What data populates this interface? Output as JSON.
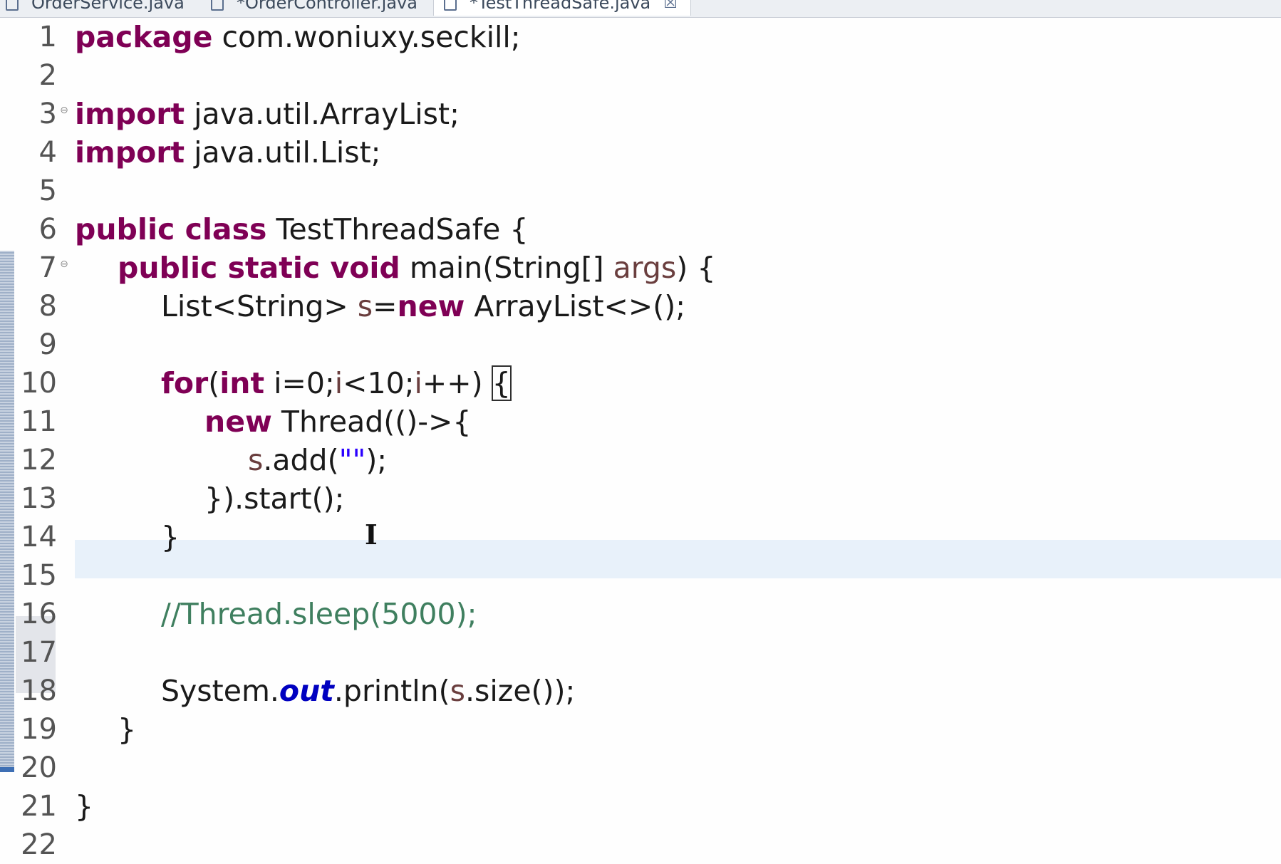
{
  "tabs": [
    {
      "label": "OrderService.java",
      "active": false
    },
    {
      "label": "*OrderController.java",
      "active": false
    },
    {
      "label": "*TestThreadSafe.java",
      "active": true,
      "close": "☒"
    }
  ],
  "gutter": {
    "line_numbers": [
      "1",
      "2",
      "3",
      "4",
      "5",
      "6",
      "7",
      "8",
      "9",
      "10",
      "11",
      "12",
      "13",
      "14",
      "15",
      "16",
      "17",
      "18",
      "19",
      "20",
      "21",
      "22"
    ],
    "fold_markers": {
      "3": "⊖",
      "7": "⊖"
    }
  },
  "code": {
    "l1_kw": "package",
    "l1_rest": " com.woniuxy.seckill;",
    "l3_kw": "import",
    "l3_rest": " java.util.ArrayList;",
    "l4_kw": "import",
    "l4_rest": " java.util.List;",
    "l6_kw": "public class",
    "l6_rest": " TestThreadSafe {",
    "l7_kw": "public static void",
    "l7_mid": " main(String[] ",
    "l7_var": "args",
    "l7_end": ") {",
    "l8_a": "List<String> ",
    "l8_var": "s",
    "l8_eq": "=",
    "l8_kw": "new",
    "l8_end": " ArrayList<>();",
    "l10_kw1": "for",
    "l10_p": "(",
    "l10_kw2": "int",
    "l10_a": " i=0;",
    "l10_b": "i",
    "l10_c": "<10;",
    "l10_d": "i",
    "l10_e": "++) ",
    "l10_brace": "{",
    "l11_kw": "new",
    "l11_rest": " Thread(()->{",
    "l12_var": "s",
    "l12_a": ".add(",
    "l12_str": "\"\"",
    "l12_b": ");",
    "l13": "}).start();",
    "l14": "}",
    "l16_comment": "//Thread.sleep(5000);",
    "l18_a": "System.",
    "l18_field": "out",
    "l18_b": ".println(",
    "l18_var": "s",
    "l18_c": ".size());",
    "l19": "}",
    "l21": "}"
  }
}
